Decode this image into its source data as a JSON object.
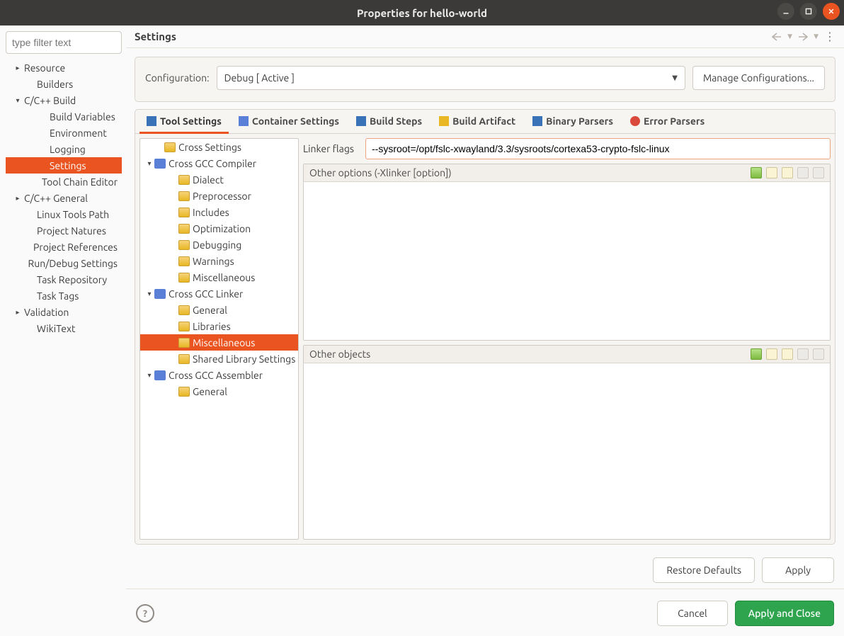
{
  "window": {
    "title": "Properties for hello-world"
  },
  "sidebar": {
    "filter_placeholder": "type filter text",
    "items": [
      {
        "label": "Resource",
        "expandable": true,
        "expanded": false,
        "indent": 0
      },
      {
        "label": "Builders",
        "expandable": false,
        "indent": 1
      },
      {
        "label": "C/C++ Build",
        "expandable": true,
        "expanded": true,
        "indent": 0
      },
      {
        "label": "Build Variables",
        "expandable": false,
        "indent": 2
      },
      {
        "label": "Environment",
        "expandable": false,
        "indent": 2
      },
      {
        "label": "Logging",
        "expandable": false,
        "indent": 2
      },
      {
        "label": "Settings",
        "expandable": false,
        "indent": 2,
        "selected": true
      },
      {
        "label": "Tool Chain Editor",
        "expandable": false,
        "indent": 2
      },
      {
        "label": "C/C++ General",
        "expandable": true,
        "expanded": false,
        "indent": 0
      },
      {
        "label": "Linux Tools Path",
        "expandable": false,
        "indent": 1
      },
      {
        "label": "Project Natures",
        "expandable": false,
        "indent": 1
      },
      {
        "label": "Project References",
        "expandable": false,
        "indent": 1
      },
      {
        "label": "Run/Debug Settings",
        "expandable": false,
        "indent": 1
      },
      {
        "label": "Task Repository",
        "expandable": false,
        "indent": 1
      },
      {
        "label": "Task Tags",
        "expandable": false,
        "indent": 1
      },
      {
        "label": "Validation",
        "expandable": true,
        "expanded": false,
        "indent": 0
      },
      {
        "label": "WikiText",
        "expandable": false,
        "indent": 1
      }
    ]
  },
  "header": {
    "title": "Settings"
  },
  "config": {
    "label": "Configuration:",
    "value": "Debug  [ Active ]",
    "manage_label": "Manage Configurations..."
  },
  "tabs": [
    {
      "label": "Tool Settings",
      "active": true,
      "iconClass": "ti-tool"
    },
    {
      "label": "Container Settings",
      "active": false,
      "iconClass": "ti-cont"
    },
    {
      "label": "Build Steps",
      "active": false,
      "iconClass": "ti-steps"
    },
    {
      "label": "Build Artifact",
      "active": false,
      "iconClass": "ti-art"
    },
    {
      "label": "Binary Parsers",
      "active": false,
      "iconClass": "ti-bin"
    },
    {
      "label": "Error Parsers",
      "active": false,
      "iconClass": "ti-err"
    }
  ],
  "tooltree": [
    {
      "label": "Cross Settings",
      "icon": "folder",
      "indent": 1
    },
    {
      "label": "Cross GCC Compiler",
      "icon": "wrench",
      "indent": 0,
      "expandable": true,
      "expanded": true
    },
    {
      "label": "Dialect",
      "icon": "folder",
      "indent": 2
    },
    {
      "label": "Preprocessor",
      "icon": "folder",
      "indent": 2
    },
    {
      "label": "Includes",
      "icon": "folder",
      "indent": 2
    },
    {
      "label": "Optimization",
      "icon": "folder",
      "indent": 2
    },
    {
      "label": "Debugging",
      "icon": "folder",
      "indent": 2
    },
    {
      "label": "Warnings",
      "icon": "folder",
      "indent": 2
    },
    {
      "label": "Miscellaneous",
      "icon": "folder",
      "indent": 2
    },
    {
      "label": "Cross GCC Linker",
      "icon": "wrench",
      "indent": 0,
      "expandable": true,
      "expanded": true
    },
    {
      "label": "General",
      "icon": "folder",
      "indent": 2
    },
    {
      "label": "Libraries",
      "icon": "folder",
      "indent": 2
    },
    {
      "label": "Miscellaneous",
      "icon": "folder",
      "indent": 2,
      "selected": true
    },
    {
      "label": "Shared Library Settings",
      "icon": "folder",
      "indent": 2
    },
    {
      "label": "Cross GCC Assembler",
      "icon": "wrench",
      "indent": 0,
      "expandable": true,
      "expanded": true
    },
    {
      "label": "General",
      "icon": "folder",
      "indent": 2
    }
  ],
  "form": {
    "linker_flags_label": "Linker flags",
    "linker_flags_value": "--sysroot=/opt/fslc-xwayland/3.3/sysroots/cortexa53-crypto-fslc-linux",
    "other_options_label": "Other options (-Xlinker [option])",
    "other_objects_label": "Other objects"
  },
  "buttons": {
    "restore": "Restore Defaults",
    "apply": "Apply",
    "cancel": "Cancel",
    "apply_close": "Apply and Close"
  }
}
